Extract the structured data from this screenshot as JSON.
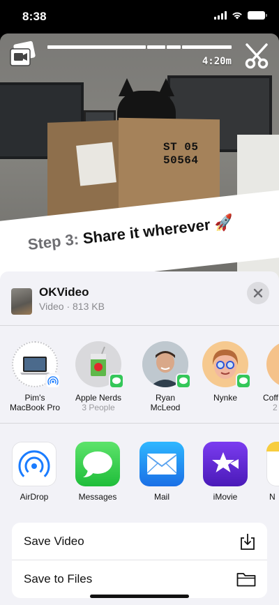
{
  "status": {
    "time": "8:38",
    "icons": [
      "cellular-signal-icon",
      "wifi-icon",
      "battery-icon"
    ]
  },
  "video": {
    "duration": "4:20m",
    "box_text_line1": "ST 05",
    "box_text_line2": "50564",
    "icons": [
      "gallery-icon",
      "scissors-icon"
    ]
  },
  "banner": {
    "prefix": "Step 3:",
    "main": "Share it wherever",
    "emoji": "🚀"
  },
  "share_sheet": {
    "app_title": "OKVideo",
    "app_sub": "Video · 813 KB",
    "people": [
      {
        "name": "Pim's\nMacBook Pro",
        "sub": ""
      },
      {
        "name": "Apple Nerds",
        "sub": "3 People"
      },
      {
        "name": "Ryan\nMcLeod",
        "sub": ""
      },
      {
        "name": "Nynke",
        "sub": ""
      },
      {
        "name": "Coff",
        "sub": "2"
      }
    ],
    "apps": [
      {
        "label": "AirDrop",
        "color": "#ffffff"
      },
      {
        "label": "Messages",
        "color": "#34c759"
      },
      {
        "label": "Mail",
        "color": "#1a8cff"
      },
      {
        "label": "iMovie",
        "color": "#5b2bd1"
      },
      {
        "label": "N",
        "color": "#ffffff"
      }
    ],
    "actions": [
      {
        "label": "Save Video",
        "icon": "save-download-icon"
      },
      {
        "label": "Save to Files",
        "icon": "folder-icon"
      }
    ]
  }
}
